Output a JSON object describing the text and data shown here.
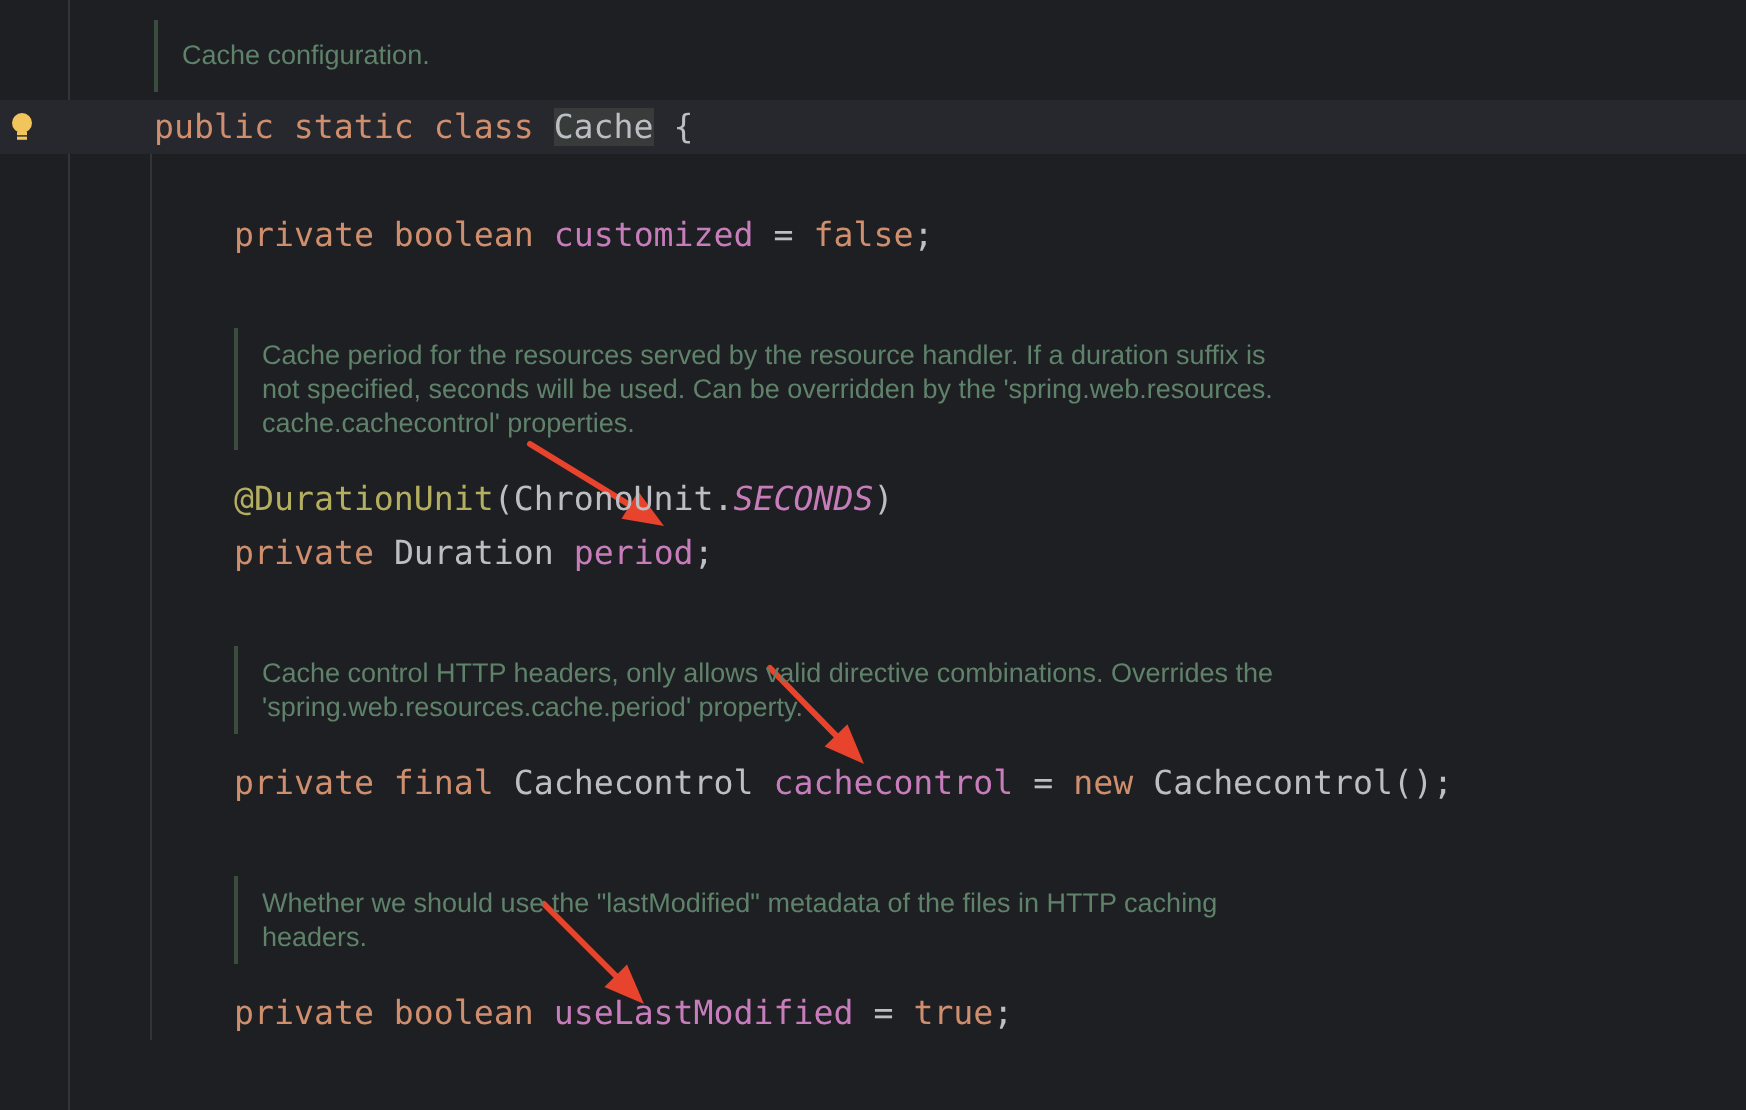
{
  "editor": {
    "class_doc": [
      "Cache configuration."
    ],
    "header": {
      "current_line": true,
      "tokens": [
        {
          "kind": "keyword",
          "text": "public static class "
        },
        {
          "kind": "plain",
          "text": "Cache",
          "highlighted": true
        },
        {
          "kind": "plain",
          "text": " {"
        }
      ]
    },
    "members": [
      {
        "kind": "blank"
      },
      {
        "kind": "code",
        "tokens": [
          {
            "kind": "keyword",
            "text": "private boolean "
          },
          {
            "kind": "field",
            "text": "customized"
          },
          {
            "kind": "plain",
            "text": " = "
          },
          {
            "kind": "keyword",
            "text": "false"
          },
          {
            "kind": "plain",
            "text": ";"
          }
        ]
      },
      {
        "kind": "blank"
      },
      {
        "kind": "doc",
        "lines": [
          "Cache period for the resources served by the resource handler. If a duration suffix is",
          "not specified, seconds will be used. Can be overridden by the 'spring.web.resources.",
          "cache.cachecontrol' properties."
        ]
      },
      {
        "kind": "code",
        "tokens": [
          {
            "kind": "annotation",
            "text": "@DurationUnit"
          },
          {
            "kind": "plain",
            "text": "(ChronoUnit."
          },
          {
            "kind": "constant",
            "text": "SECONDS"
          },
          {
            "kind": "plain",
            "text": ")"
          }
        ]
      },
      {
        "kind": "code",
        "tokens": [
          {
            "kind": "keyword",
            "text": "private "
          },
          {
            "kind": "plain",
            "text": "Duration "
          },
          {
            "kind": "field",
            "text": "period"
          },
          {
            "kind": "plain",
            "text": ";"
          }
        ]
      },
      {
        "kind": "blank"
      },
      {
        "kind": "doc",
        "lines": [
          "Cache control HTTP headers, only allows valid directive combinations. Overrides the",
          "'spring.web.resources.cache.period' property."
        ]
      },
      {
        "kind": "code",
        "tokens": [
          {
            "kind": "keyword",
            "text": "private final "
          },
          {
            "kind": "plain",
            "text": "Cachecontrol "
          },
          {
            "kind": "field",
            "text": "cachecontrol"
          },
          {
            "kind": "plain",
            "text": " = "
          },
          {
            "kind": "keyword",
            "text": "new "
          },
          {
            "kind": "plain",
            "text": "Cachecontrol();"
          }
        ]
      },
      {
        "kind": "blank"
      },
      {
        "kind": "doc",
        "lines": [
          "Whether we should use the \"lastModified\" metadata of the files in HTTP caching",
          "headers."
        ]
      },
      {
        "kind": "code",
        "tokens": [
          {
            "kind": "keyword",
            "text": "private boolean "
          },
          {
            "kind": "field",
            "text": "useLastModified"
          },
          {
            "kind": "plain",
            "text": " = "
          },
          {
            "kind": "keyword",
            "text": "true"
          },
          {
            "kind": "plain",
            "text": ";"
          }
        ]
      }
    ]
  }
}
